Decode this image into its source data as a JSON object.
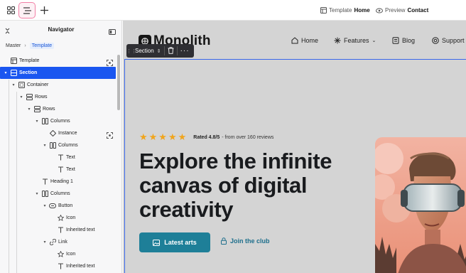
{
  "topbar": {
    "template_label": "Template",
    "template_value": "Home",
    "preview_label": "Preview",
    "preview_value": "Contact",
    "icons": [
      "grid-icon",
      "navigator-icon",
      "plus-icon"
    ]
  },
  "navigator": {
    "title": "Navigator",
    "breadcrumb": [
      "Master",
      "Template"
    ],
    "tree": [
      {
        "label": "Template",
        "icon": "template-icon"
      },
      {
        "label": "Section",
        "icon": "section-icon",
        "selected": true
      },
      {
        "label": "Container",
        "icon": "container-icon"
      },
      {
        "label": "Rows",
        "icon": "rows-icon"
      },
      {
        "label": "Rows",
        "icon": "rows-icon"
      },
      {
        "label": "Columns",
        "icon": "columns-icon"
      },
      {
        "label": "Instance",
        "icon": "instance-icon"
      },
      {
        "label": "Columns",
        "icon": "columns-icon"
      },
      {
        "label": "Text",
        "icon": "text-icon"
      },
      {
        "label": "Text",
        "icon": "text-icon"
      },
      {
        "label": "Heading 1",
        "icon": "heading-icon"
      },
      {
        "label": "Columns",
        "icon": "columns-icon"
      },
      {
        "label": "Button",
        "icon": "button-icon"
      },
      {
        "label": "Icon",
        "icon": "star-icon"
      },
      {
        "label": "Inherited text",
        "icon": "text-icon"
      },
      {
        "label": "Link",
        "icon": "link-icon"
      },
      {
        "label": "Icon",
        "icon": "star-icon"
      },
      {
        "label": "Inherited text",
        "icon": "text-icon"
      }
    ]
  },
  "canvas": {
    "selection_toolbar": {
      "label": "Section"
    },
    "brand": "Monolith",
    "menu": [
      "Home",
      "Features",
      "Blog",
      "Support"
    ],
    "rating": {
      "stars": 5,
      "score": "Rated 4.8/5",
      "reviews": "- from over 160 reviews"
    },
    "hero_title": "Explore the infinite canvas of digital creativity",
    "primary_button": "Latest arts",
    "secondary_link": "Join the club"
  },
  "colors": {
    "accent": "#1a56f0",
    "primary_button": "#1e7f98",
    "star": "#f0a51d",
    "canvas_bg": "#d4d4d4"
  }
}
